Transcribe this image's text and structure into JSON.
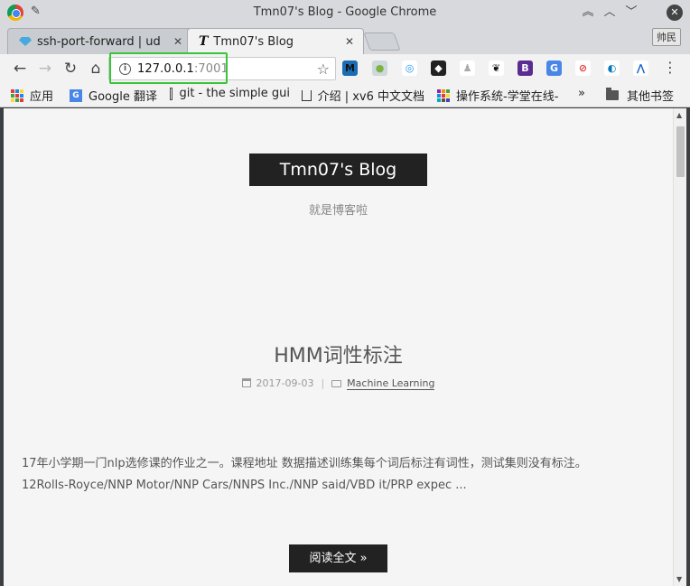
{
  "window": {
    "title": "Tmn07's Blog - Google Chrome",
    "controls": {
      "up": "︽",
      "upsmall": "︿",
      "down": "﹀",
      "close": "✕"
    }
  },
  "tabs": [
    {
      "label": "ssh-port-forward | ud",
      "close": "✕"
    },
    {
      "label": "Tmn07's Blog",
      "close": "✕"
    }
  ],
  "profile": {
    "label": "帅民"
  },
  "toolbar": {
    "back": "←",
    "forward": "→",
    "reload": "↻",
    "home": "⌂",
    "url_host": "127.0.0.1",
    "url_port": ":7001",
    "star": "☆",
    "menu": "⋮"
  },
  "extensions": [
    {
      "name": "m-ext",
      "glyph": "M",
      "color": "#1a6db5",
      "fg": "#111"
    },
    {
      "name": "pinwheel-ext",
      "glyph": "●",
      "color": "#cfd8dc",
      "fg": "#7cb342"
    },
    {
      "name": "target-ext",
      "glyph": "◎",
      "color": "#ffffff",
      "fg": "#2196f3"
    },
    {
      "name": "face-ext",
      "glyph": "◆",
      "color": "#222222",
      "fg": "#ffffff"
    },
    {
      "name": "bell-ext",
      "glyph": "♟",
      "color": "#ffffff",
      "fg": "#aaaaaa"
    },
    {
      "name": "paw-ext",
      "glyph": "❦",
      "color": "#ffffff",
      "fg": "#111111"
    },
    {
      "name": "b-ext",
      "glyph": "B",
      "color": "#5b2c91",
      "fg": "#ffffff"
    },
    {
      "name": "translate-ext",
      "glyph": "G",
      "color": "#4a86e8",
      "fg": "#ffffff"
    },
    {
      "name": "stop-ext",
      "glyph": "⊘",
      "color": "#ffffff",
      "fg": "#e53935"
    },
    {
      "name": "wave-ext",
      "glyph": "◐",
      "color": "#ffffff",
      "fg": "#0277bd"
    },
    {
      "name": "lambda-ext",
      "glyph": "⋀",
      "color": "#ffffff",
      "fg": "#1565c0"
    }
  ],
  "bookmarks": [
    {
      "label": "应用"
    },
    {
      "label": "Google 翻译"
    },
    {
      "label": "git - the simple gui"
    },
    {
      "label": "介绍 | xv6 中文文档"
    },
    {
      "label": "操作系统-学堂在线-"
    },
    {
      "label": "»"
    },
    {
      "label": "其他书签"
    }
  ],
  "blog": {
    "site_title": "Tmn07's Blog",
    "site_subtitle": "就是博客啦",
    "post": {
      "title": "HMM词性标注",
      "date": "2017-09-03",
      "separator": "|",
      "category": "Machine Learning",
      "excerpt_line1": "17年小学期一门nlp选修课的作业之一。课程地址 数据描述训练集每个词后标注有词性，测试集则没有标注。",
      "excerpt_line2": "12Rolls-Royce/NNP Motor/NNP Cars/NNPS Inc./NNP said/VBD it/PRP expec ...",
      "read_more": "阅读全文 »"
    }
  },
  "scrollbar": {
    "position_fraction": 0.0
  }
}
